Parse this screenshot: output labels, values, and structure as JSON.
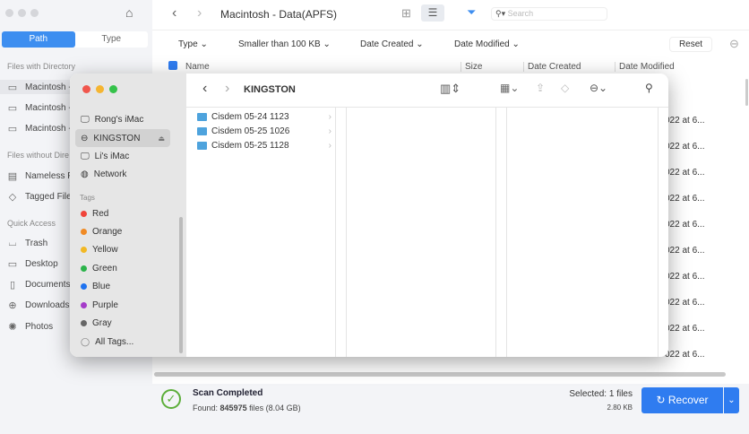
{
  "sidebar": {
    "tabs": [
      "Path",
      "Type"
    ],
    "section_dir": "Files with Directory",
    "dir_items": [
      "Macintosh -",
      "Macintosh -",
      "Macintosh -"
    ],
    "section_nodir": "Files without Dire",
    "nodir_items": [
      "Nameless F",
      "Tagged File"
    ],
    "section_quick": "Quick Access",
    "quick_items": [
      "Trash",
      "Desktop",
      "Documents",
      "Downloads",
      "Photos"
    ]
  },
  "toolbar": {
    "title": "Macintosh - Data(APFS)",
    "search_placeholder": "Search"
  },
  "filters": {
    "type": "Type",
    "size": "Smaller than 100 KB",
    "created": "Date Created",
    "modified": "Date Modified",
    "reset": "Reset"
  },
  "columns": {
    "name": "Name",
    "size": "Size",
    "created": "Date Created",
    "modified": "Date Modified"
  },
  "rows": [
    "022 at 6...",
    "022 at 6...",
    "022 at 6...",
    "022 at 6...",
    "022 at 6...",
    "022 at 6...",
    "022 at 6...",
    "022 at 6...",
    "022 at 6...",
    "022 at 6..."
  ],
  "status": {
    "title": "Scan Completed",
    "found_label": "Found:",
    "found_count": "845975",
    "found_suffix": "files (8.04 GB)",
    "selected": "Selected: 1 files",
    "selected_size": "2.80 KB",
    "recover": "Recover"
  },
  "finder": {
    "title": "KINGSTON",
    "locations": [
      "Rong's iMac",
      "KINGSTON",
      "Li's iMac",
      "Network"
    ],
    "tags_header": "Tags",
    "tags": [
      {
        "label": "Red",
        "color": "#f0443a"
      },
      {
        "label": "Orange",
        "color": "#f08a24"
      },
      {
        "label": "Yellow",
        "color": "#f2b824"
      },
      {
        "label": "Green",
        "color": "#2bb34a"
      },
      {
        "label": "Blue",
        "color": "#1f73f0"
      },
      {
        "label": "Purple",
        "color": "#a53cc9"
      },
      {
        "label": "Gray",
        "color": "#666666"
      }
    ],
    "all_tags": "All Tags...",
    "folders": [
      "Cisdem 05-24 1123",
      "Cisdem 05-25 1026",
      "Cisdem 05-25 1128"
    ]
  },
  "colors": {
    "accent": "#2f7cf0",
    "success": "#5cae3a"
  }
}
